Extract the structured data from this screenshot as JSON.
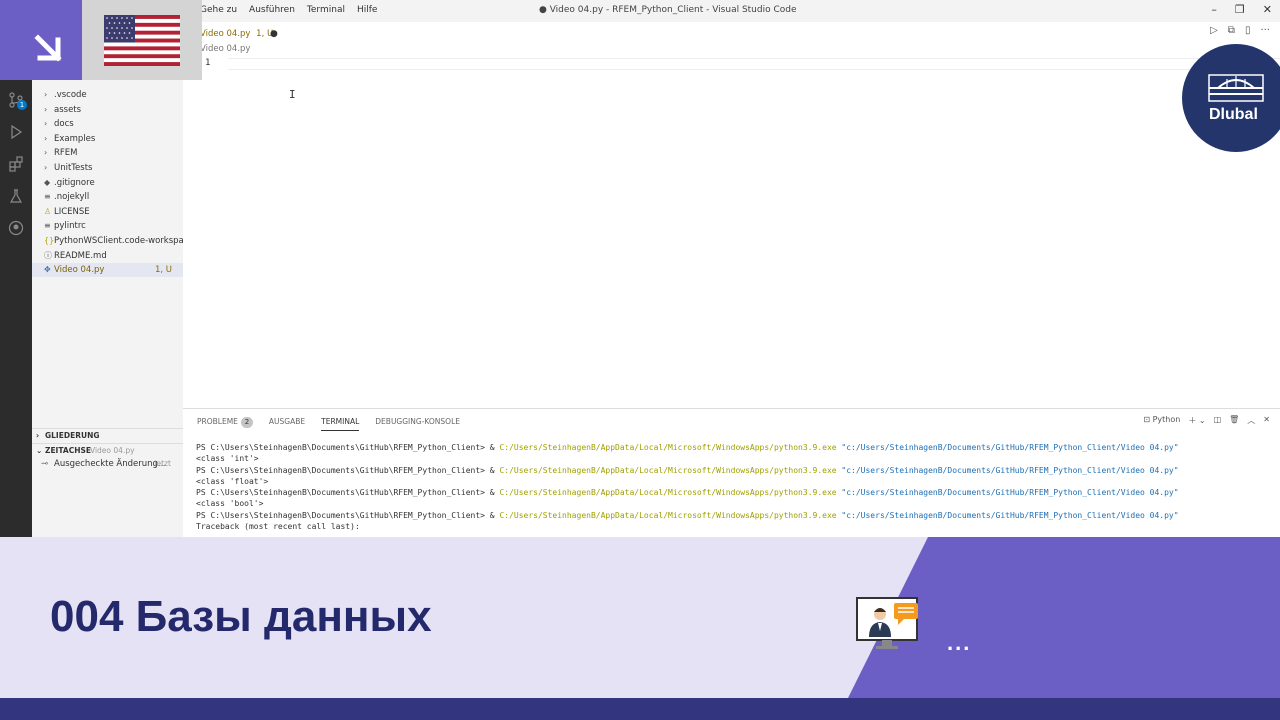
{
  "titlebar": {
    "menu": [
      "Gehe zu",
      "Ausführen",
      "Terminal",
      "Hilfe"
    ],
    "window_title": "● Video 04.py - RFEM_Python_Client - Visual Studio Code"
  },
  "activity": {
    "scm_badge": "1"
  },
  "explorer": {
    "items": [
      {
        "label": ".vscode",
        "type": "folder"
      },
      {
        "label": "assets",
        "type": "folder"
      },
      {
        "label": "docs",
        "type": "folder"
      },
      {
        "label": "Examples",
        "type": "folder"
      },
      {
        "label": "RFEM",
        "type": "folder"
      },
      {
        "label": "UnitTests",
        "type": "folder"
      },
      {
        "label": ".gitignore",
        "type": "file",
        "icon": "git-icon"
      },
      {
        "label": ".nojekyll",
        "type": "file",
        "icon": "file-icon"
      },
      {
        "label": "LICENSE",
        "type": "file",
        "icon": "license-icon"
      },
      {
        "label": "pylintrc",
        "type": "file",
        "icon": "file-icon"
      },
      {
        "label": "PythonWSClient.code-workspace",
        "type": "file",
        "icon": "braces-icon"
      },
      {
        "label": "README.md",
        "type": "file",
        "icon": "info-icon"
      },
      {
        "label": "Video 04.py",
        "type": "file",
        "icon": "python-icon",
        "meta": "1, U"
      }
    ],
    "outline_label": "GLIEDERUNG",
    "timeline_label": "ZEITACHSE",
    "timeline_file": "Video 04.py",
    "timeline_item": "Ausgecheckte Änderung...",
    "timeline_time": "jetzt"
  },
  "editor": {
    "tab_label": "Video 04.py",
    "tab_meta": "1, U",
    "breadcrumb": "Video 04.py",
    "line_number": "1"
  },
  "panel": {
    "tabs": [
      "PROBLEME",
      "AUSGABE",
      "TERMINAL",
      "DEBUGGING-KONSOLE"
    ],
    "problems_count": "2",
    "active_tab": "TERMINAL",
    "terminal_profile": "Python",
    "terminal_lines": [
      {
        "type": "cmd",
        "prompt": "PS C:\\Users\\SteinhagenB\\Documents\\GitHub\\RFEM_Python_Client> & ",
        "exe": "C:/Users/SteinhagenB/AppData/Local/Microsoft/WindowsApps/python3.9.exe",
        "arg": " \"c:/Users/SteinhagenB/Documents/GitHub/RFEM_Python_Client/Video 04.py\""
      },
      {
        "type": "out",
        "text": "<class 'int'>"
      },
      {
        "type": "cmd",
        "prompt": "PS C:\\Users\\SteinhagenB\\Documents\\GitHub\\RFEM_Python_Client> & ",
        "exe": "C:/Users/SteinhagenB/AppData/Local/Microsoft/WindowsApps/python3.9.exe",
        "arg": " \"c:/Users/SteinhagenB/Documents/GitHub/RFEM_Python_Client/Video 04.py\""
      },
      {
        "type": "out",
        "text": "<class 'float'>"
      },
      {
        "type": "cmd",
        "prompt": "PS C:\\Users\\SteinhagenB\\Documents\\GitHub\\RFEM_Python_Client> & ",
        "exe": "C:/Users/SteinhagenB/AppData/Local/Microsoft/WindowsApps/python3.9.exe",
        "arg": " \"c:/Users/SteinhagenB/Documents/GitHub/RFEM_Python_Client/Video 04.py\""
      },
      {
        "type": "out",
        "text": "<class 'bool'>"
      },
      {
        "type": "cmd",
        "prompt": "PS C:\\Users\\SteinhagenB\\Documents\\GitHub\\RFEM_Python_Client> & ",
        "exe": "C:/Users/SteinhagenB/AppData/Local/Microsoft/WindowsApps/python3.9.exe",
        "arg": " \"c:/Users/SteinhagenB/Documents/GitHub/RFEM_Python_Client/Video 04.py\""
      },
      {
        "type": "out",
        "text": "Traceback (most recent call last):"
      }
    ]
  },
  "overlay": {
    "logo_text": "Dlubal",
    "banner_title": "004 Базы данных",
    "dots": "...",
    "colors": {
      "accent_purple": "#6b5fc6",
      "banner_bg": "#e6e2f6",
      "title_navy": "#23296b",
      "logo_navy": "#23356b",
      "bottom_bar": "#33357e"
    }
  }
}
